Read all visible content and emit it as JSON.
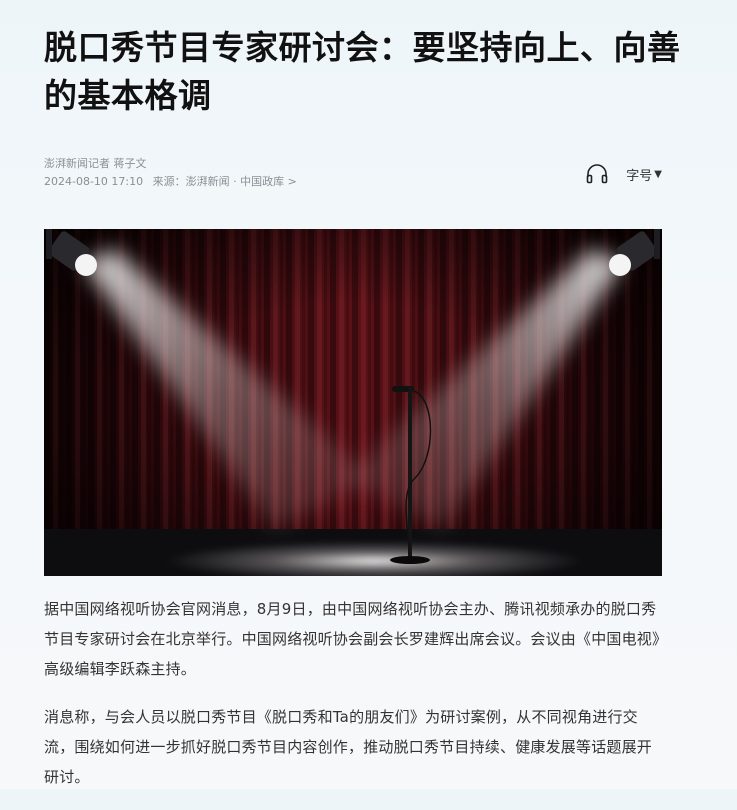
{
  "article": {
    "title": "脱口秀节目专家研讨会：要坚持向上、向善的基本格调",
    "byline": "澎湃新闻记者 蒋子文",
    "datetime": "2024-08-10 17:10",
    "source_label": "来源：",
    "source_value": "澎湃新闻 · 中国政库 >",
    "tools": {
      "listen_icon": "headphones-icon",
      "font_size_label": "字号",
      "font_size_caret": "▼"
    },
    "paragraphs": [
      "据中国网络视听协会官网消息，8月9日，由中国网络视听协会主办、腾讯视频承办的脱口秀节目专家研讨会在北京举行。中国网络视听协会副会长罗建辉出席会议。会议由《中国电视》高级编辑李跃森主持。",
      "消息称，与会人员以脱口秀节目《脱口秀和Ta的朋友们》为研讨案例，从不同视角进行交流，围绕如何进一步抓好脱口秀节目内容创作，推动脱口秀节目持续、健康发展等话题展开研讨。"
    ]
  },
  "colors": {
    "title": "#111111",
    "meta": "#8a8f95",
    "body": "#333333",
    "curtain": "#4a0d12"
  }
}
